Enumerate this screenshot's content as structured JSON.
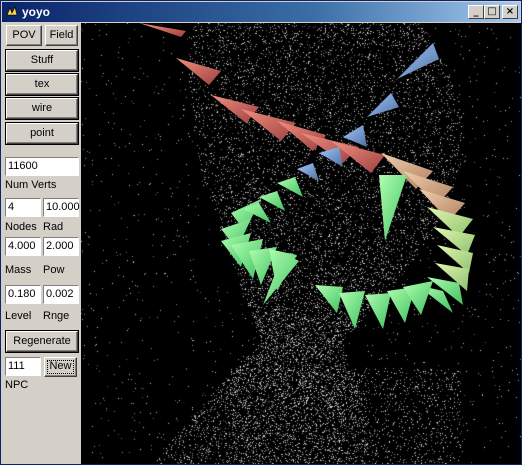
{
  "window": {
    "title": "yoyo",
    "icon": "app-icon",
    "minimize": "_",
    "maximize": "□",
    "close": "×"
  },
  "panel": {
    "pov_label": "POV",
    "field_label": "Field",
    "stuff_label": "Stuff",
    "tex_label": "tex",
    "wire_label": "wire",
    "point_label": "point",
    "num_verts_value": "11600",
    "num_verts_label": "Num Verts",
    "nodes_value": "4",
    "rad_value": "10.000",
    "nodes_label": "Nodes",
    "rad_label": "Rad",
    "mass_value": "4.000",
    "pow_value": "2.000",
    "mass_label": "Mass",
    "pow_label": "Pow",
    "level_value": "0.180",
    "rnge_value": "0.002",
    "level_label": "Level",
    "rnge_label": "Rnge",
    "regenerate_label": "Regenerate",
    "npc_value": "111",
    "new_label": "New",
    "npc_label": "NPC"
  },
  "viewport": {
    "background": "#000000",
    "point_color": "#ffffff",
    "cone_colors": [
      "#d9746a",
      "#c8b0a0",
      "#b0e090",
      "#90f090",
      "#6ab0e0"
    ]
  }
}
